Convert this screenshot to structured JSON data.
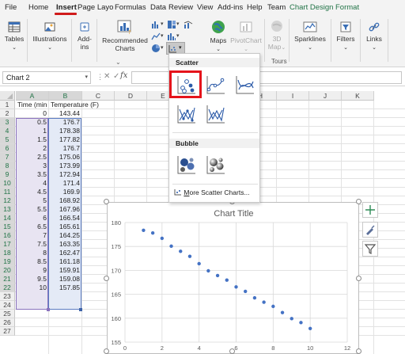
{
  "menu": {
    "tabs": [
      "File",
      "Home",
      "Insert",
      "Page Layo",
      "Formulas",
      "Data",
      "Review",
      "View",
      "Add-ins",
      "Help",
      "Team",
      "Chart Design",
      "Format"
    ],
    "active_tab": "Insert"
  },
  "ribbon": {
    "tables": "Tables",
    "illustrations": "Illustrations",
    "addins_l1": "Add-",
    "addins_l2": "ins",
    "recommended_l1": "Recommended",
    "recommended_l2": "Charts",
    "maps": "Maps",
    "pivotchart": "PivotChart",
    "map3d_l1": "3D",
    "map3d_l2": "Map",
    "sparklines": "Sparklines",
    "filters": "Filters",
    "links": "Links",
    "tours": "Tours"
  },
  "formula_bar": {
    "name_box": "Chart 2",
    "fx": "fx",
    "value": ""
  },
  "columns": [
    "A",
    "B",
    "C",
    "D",
    "E",
    "F",
    "G",
    "H",
    "I",
    "J",
    "K"
  ],
  "rows": [
    "1",
    "2",
    "3",
    "4",
    "5",
    "6",
    "7",
    "8",
    "9",
    "10",
    "11",
    "12",
    "13",
    "14",
    "15",
    "16",
    "17",
    "18",
    "19",
    "20",
    "21",
    "22",
    "23",
    "24",
    "25",
    "26",
    "27"
  ],
  "sheet": {
    "header_a": "Time (min",
    "header_b": "Temperature (F)",
    "time": [
      "0",
      "0.5",
      "1",
      "1.5",
      "2",
      "2.5",
      "3",
      "3.5",
      "4",
      "4.5",
      "5",
      "5.5",
      "6",
      "6.5",
      "7",
      "7.5",
      "8",
      "8.5",
      "9",
      "9.5",
      "10"
    ],
    "temp": [
      "143.44",
      "176.7",
      "178.38",
      "177.82",
      "176.7",
      "175.06",
      "173.99",
      "172.94",
      "171.4",
      "169.9",
      "168.92",
      "167.96",
      "166.54",
      "165.61",
      "164.25",
      "163.35",
      "162.47",
      "161.18",
      "159.91",
      "159.08",
      "157.85"
    ]
  },
  "dropdown": {
    "scatter_heading": "Scatter",
    "bubble_heading": "Bubble",
    "more_prefix": "M",
    "more_rest": "ore Scatter Charts...",
    "items": [
      "scatter",
      "scatter-smooth-lines-markers",
      "scatter-smooth-lines",
      "scatter-straight-lines-markers",
      "scatter-straight-lines",
      "bubble",
      "3d-bubble"
    ]
  },
  "chart_data": {
    "type": "scatter",
    "title": "Chart Title",
    "xlabel": "",
    "ylabel": "",
    "xlim": [
      0,
      12
    ],
    "ylim": [
      155,
      180
    ],
    "xticks": [
      "0",
      "2",
      "4",
      "6",
      "8",
      "10",
      "12"
    ],
    "yticks": [
      "180",
      "175",
      "170",
      "165",
      "160",
      "155"
    ],
    "grid": true,
    "marker_color": "#4472c4",
    "x": [
      1,
      1.5,
      2,
      2.5,
      3,
      3.5,
      4,
      4.5,
      5,
      5.5,
      6,
      6.5,
      7,
      7.5,
      8,
      8.5,
      9,
      9.5,
      10
    ],
    "y": [
      178.38,
      177.82,
      176.7,
      175.06,
      173.99,
      172.94,
      171.4,
      169.9,
      168.92,
      167.96,
      166.54,
      165.61,
      164.25,
      163.35,
      162.47,
      161.18,
      159.91,
      159.08,
      157.85
    ]
  },
  "colors": {
    "accent_green": "#217346",
    "highlight_red": "#e5141b",
    "series_blue": "#4472c4"
  }
}
